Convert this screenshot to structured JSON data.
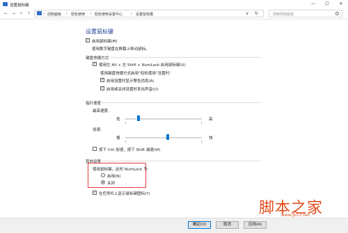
{
  "window": {
    "title": "设置鼠标键",
    "minimize": "—",
    "maximize": "☐",
    "close": "✕"
  },
  "address": {
    "back": "←",
    "forward": "→",
    "dropdown": "∨",
    "up": "↑",
    "crumbs": [
      "控制面板",
      "轻松使用",
      "轻松使用设置中心",
      "设置鼠标键"
    ],
    "separator": "›",
    "refresh": "↻",
    "search_placeholder": "搜索控制面板"
  },
  "page": {
    "heading": "设置鼠标键",
    "enable_label": "启用鼠标键(M)",
    "enable_desc": "使用数字键盘在屏幕上移动鼠标。",
    "shortcut": {
      "title": "键盘快捷方式",
      "use_shortcut_label": "使用左 Alt + 左 Shift + NumLock 启用鼠标键(U)",
      "hint": "使用键盘快捷方式启用“轻松使用”设置时:",
      "warning_label": "启用设置时显示警告消息(A)",
      "sound_label": "启用或关闭设置时发出声音(U)"
    },
    "pointer": {
      "title": "指针速度",
      "max_speed_label": "最高速度:",
      "low": "低",
      "high": "高",
      "accel_label": "加速:",
      "slow": "慢",
      "fast": "快",
      "ctrl_shift_label": "按下 Ctrl 加速，按下 Shift 减速(W)",
      "max_speed_level": 0.17,
      "accel_level": 0.55
    },
    "other": {
      "title": "其他设置",
      "numlock_label": "使用鼠标键，此时 NumLock 为:",
      "on_label": "启用(N)",
      "off_label": "关闭",
      "taskbar_label": "在任务栏上显示鼠标键图标(Y)"
    }
  },
  "footer": {
    "ok": "确定(O)",
    "cancel": "取消",
    "apply": "应用(A)"
  },
  "watermark": {
    "text": "脚本之家",
    "url": "www.jb51.net"
  },
  "colors": {
    "heading": "#1c3f94",
    "accent": "#0078d7",
    "highlight_border": "#e23a3a",
    "watermark": "#e34b1c"
  }
}
